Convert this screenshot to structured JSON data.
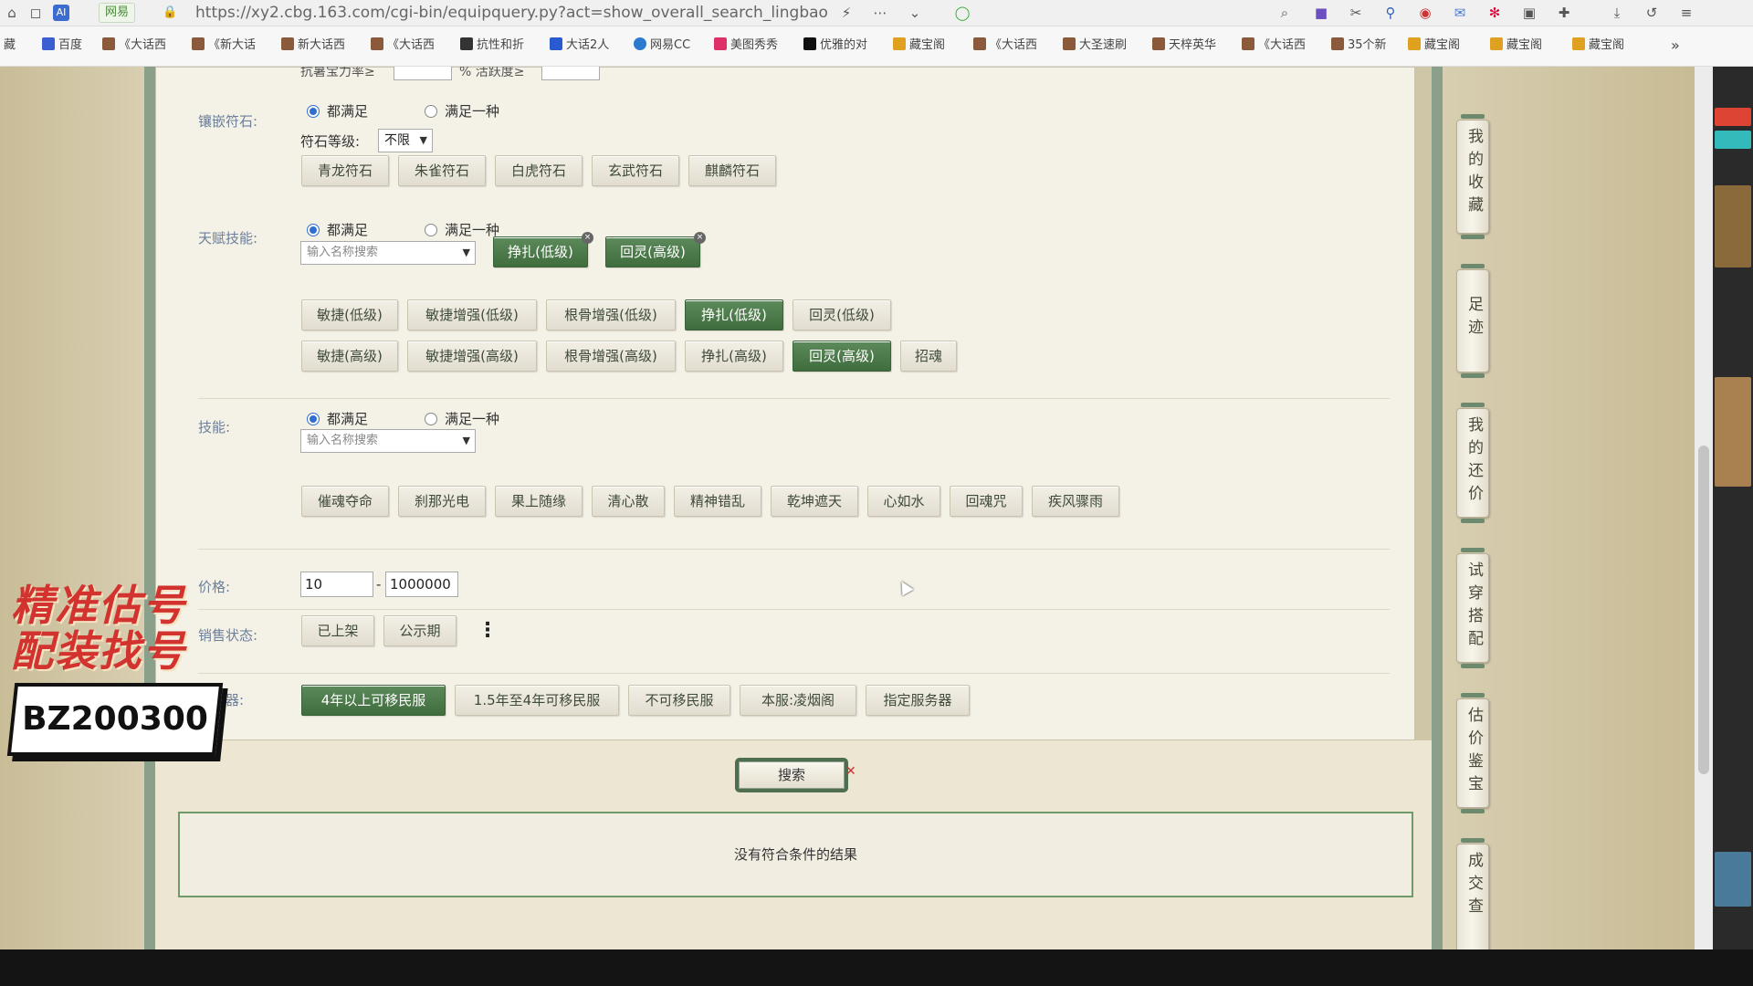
{
  "browser": {
    "site_badge": "网易",
    "url": "https://xy2.cbg.163.com/cgi-bin/equipquery.py?act=show_overall_search_lingbao"
  },
  "bookmarks": [
    "藏",
    "百度",
    "《大话西",
    "《新大话",
    "新大话西",
    "《大话西",
    "抗性和折",
    "大话2人",
    "网易CC",
    "美图秀秀",
    "优雅的对",
    "藏宝阁",
    "《大话西",
    "大圣速刷",
    "天梓英华",
    "《大话西",
    "35个新",
    "藏宝阁",
    "藏宝阁",
    "藏宝阁"
  ],
  "form": {
    "partial_top": "抗暑宝力率≥",
    "partial_top_unit": "% 活跃度≥",
    "inlay": {
      "label": "镶嵌符石:",
      "radio_all": "都满足",
      "radio_any": "满足一种",
      "level_label": "符石等级:",
      "level_value": "不限",
      "stones": [
        "青龙符石",
        "朱雀符石",
        "白虎符石",
        "玄武符石",
        "麒麟符石"
      ]
    },
    "talent": {
      "label": "天赋技能:",
      "radio_all": "都满足",
      "radio_any": "满足一种",
      "search_placeholder": "输入名称搜索",
      "selected": [
        "挣扎(低级)",
        "回灵(高级)"
      ],
      "row1": [
        "敏捷(低级)",
        "敏捷增强(低级)",
        "根骨增强(低级)",
        "挣扎(低级)",
        "回灵(低级)"
      ],
      "row2": [
        "敏捷(高级)",
        "敏捷增强(高级)",
        "根骨增强(高级)",
        "挣扎(高级)",
        "回灵(高级)",
        "招魂"
      ]
    },
    "skill": {
      "label": "技能:",
      "radio_all": "都满足",
      "radio_any": "满足一种",
      "search_placeholder": "输入名称搜索",
      "items": [
        "催魂夺命",
        "刹那光电",
        "果上随缘",
        "清心散",
        "精神错乱",
        "乾坤遮天",
        "心如水",
        "回魂咒",
        "疾风骤雨"
      ]
    },
    "price": {
      "label": "价格:",
      "min": "10",
      "max": "1000000"
    },
    "sale": {
      "label": "销售状态:",
      "items": [
        "已上架",
        "公示期"
      ]
    },
    "server": {
      "label": "服务器:",
      "items": [
        "4年以上可移民服",
        "1.5年至4年可移民服",
        "不可移民服",
        "本服:凌烟阁",
        "指定服务器"
      ]
    }
  },
  "search_button": "搜索",
  "result_text": "没有符合条件的结果",
  "side_tabs": [
    "我的收藏",
    "足迹",
    "我的还价",
    "试穿搭配",
    "估价鉴宝",
    "成交查"
  ],
  "overlay": {
    "line1": "精准估号",
    "line2": "配装找号",
    "code": "BZ200300"
  }
}
